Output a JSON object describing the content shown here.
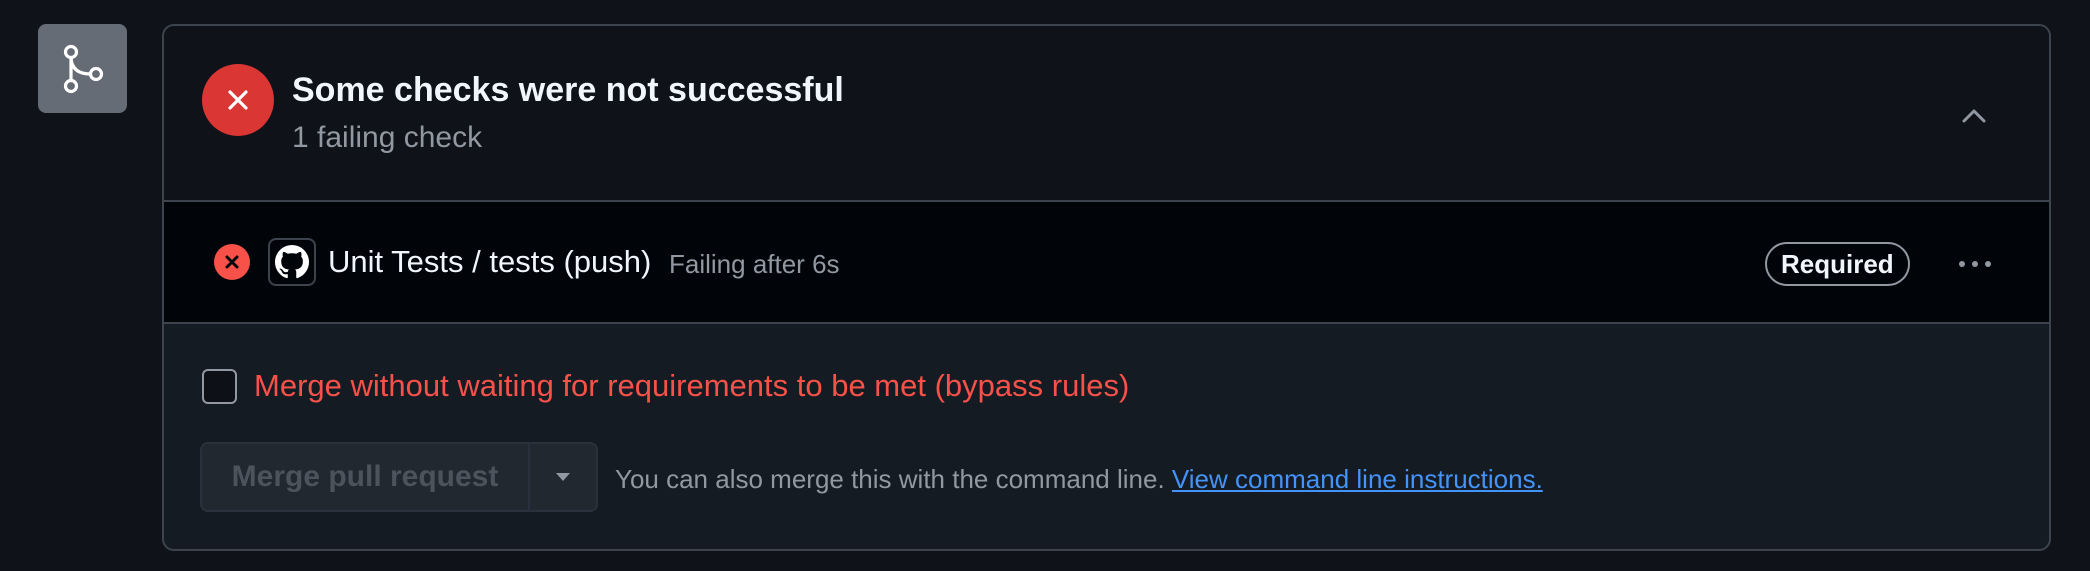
{
  "merge_icon": {
    "icon": "git-merge-icon",
    "color": "#656c76"
  },
  "status": {
    "icon": "x-circle-icon",
    "color": "#da3633",
    "title": "Some checks were not successful",
    "subtitle": "1 failing check",
    "collapse_icon": "chevron-up-icon"
  },
  "checks": [
    {
      "status_icon": "x-circle-fill-icon",
      "app_icon": "github-logo-icon",
      "name": "Unit Tests / tests (push)",
      "status_text": "Failing after 6s",
      "badge": "Required",
      "menu_icon": "kebab-horizontal-icon"
    }
  ],
  "bypass": {
    "checked": false,
    "label": "Merge without waiting for requirements to be met (bypass rules)",
    "color": "#f85149"
  },
  "merge": {
    "button_label": "Merge pull request",
    "disabled": true,
    "caret_icon": "triangle-down-icon",
    "note": "You can also merge this with the command line.",
    "link_text": "View command line instructions.",
    "link_color": "#4493f8"
  }
}
